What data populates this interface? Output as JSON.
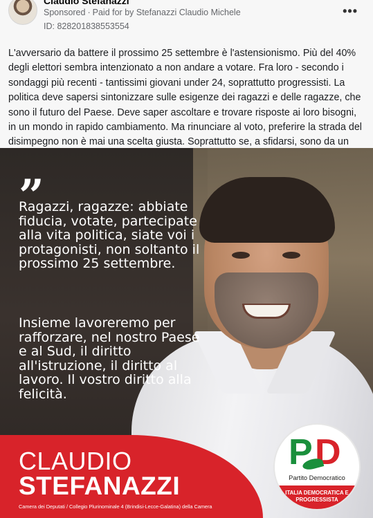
{
  "post": {
    "author": "Claudio Stefanazzi",
    "sponsored": "Sponsored",
    "paid_for": "Paid for by Stefanazzi Claudio Michele",
    "ad_id": "ID: 828201838553554",
    "more_label": "•••",
    "body": "L'avversario da battere il prossimo 25 settembre è l'astensionismo. Più del 40% degli elettori sembra intenzionato a non andare a votare. Fra loro - secondo i sondaggi più recenti - tantissimi giovani under 24, soprattutto progressisti. La politica deve sapersi sintonizzare sulle esigenze dei ragazzi e delle ragazze, che sono il futuro del Paese. Deve saper ascoltare e trovare risposte ai loro bisogni, in un mondo in rapido cambiamento. Ma rinunciare al voto, preferire la strada del disimpegno non è mai una scelta giusta. Soprattutto se, a sfidarsi, sono da un lat..."
  },
  "creative": {
    "quote_mark": "”",
    "quote_part1": "Ragazzi, ragazze: abbiate fiducia, votate, partecipate alla vita politica, siate voi i protagonisti, non soltanto il prossimo 25 settembre.",
    "quote_part2": "Insieme lavoreremo per rafforzare, nel nostro Paese e al Sud, il diritto all'istruzione, il diritto al lavoro. Il vostro diritto alla felicità.",
    "first_name": "CLAUDIO",
    "last_name": "STEFANAZZI",
    "role": "Camera dei Deputati / Collegio Plurinominale 4 (Brindisi-Lecce-Galatina) della Camera",
    "logo": {
      "letter_p": "P",
      "letter_d": "D",
      "party_name": "Partito Democratico",
      "subtitle": "ITALIA DEMOCRATICA E PROGRESSISTA"
    }
  }
}
